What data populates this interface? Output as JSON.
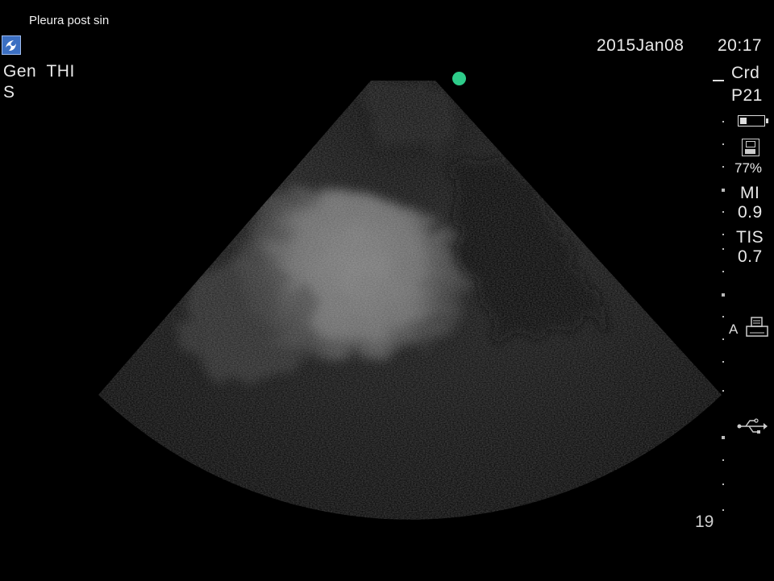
{
  "header": {
    "caption": "Pleura post sin",
    "logo_icon": "sonosite-logo-icon",
    "preset": "Gen  THI",
    "mode": "S",
    "date": "2015Jan08",
    "time": "20:17"
  },
  "status": {
    "exam": "Crd",
    "probe": "P21",
    "battery_icon": "battery-icon",
    "save_icon": "floppy-disk-icon",
    "storage_percent": "77%",
    "mi_label": "MI",
    "mi_value": "0.9",
    "tis_label": "TIS",
    "tis_value": "0.7",
    "print_mode_label": "A",
    "printer_icon": "printer-icon",
    "usb_icon": "usb-icon",
    "depth": "19"
  },
  "colors": {
    "background": "#000000",
    "orientation_marker": "#2ecc8a",
    "logo_blue": "#3b6fc2"
  }
}
